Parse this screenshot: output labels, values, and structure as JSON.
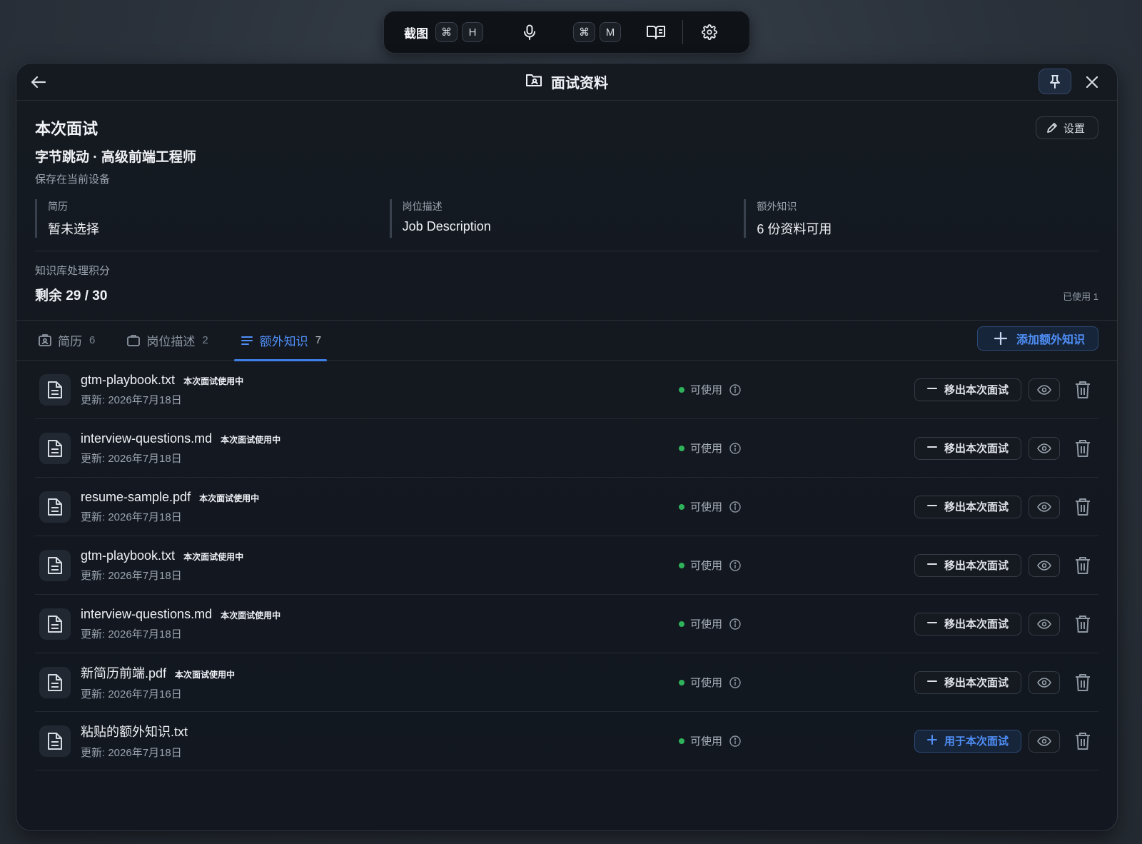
{
  "toolbar": {
    "screenshot_label": "截图",
    "shortcut1_mod": "⌘",
    "shortcut1_key": "H",
    "shortcut2_mod": "⌘",
    "shortcut2_key": "M"
  },
  "window": {
    "title": "面试资料"
  },
  "summary": {
    "heading": "本次面试",
    "position": "字节跳动 · 高级前端工程师",
    "storage_note": "保存在当前设备",
    "settings_label": "设置",
    "meta": [
      {
        "label": "简历",
        "value": "暂未选择"
      },
      {
        "label": "岗位描述",
        "value": "Job Description"
      },
      {
        "label": "额外知识",
        "value": "6 份资料可用"
      }
    ],
    "credits_label": "知识库处理积分",
    "credits_value": "剩余 29 / 30",
    "credits_used": "已使用 1"
  },
  "tabs": [
    {
      "label": "简历",
      "count": "6",
      "icon": "resume-icon"
    },
    {
      "label": "岗位描述",
      "count": "2",
      "icon": "briefcase-icon"
    },
    {
      "label": "额外知识",
      "count": "7",
      "icon": "list-icon",
      "active": true
    }
  ],
  "add_button_label": "添加额外知识",
  "status_label": "可使用",
  "files": [
    {
      "name": "gtm-playbook.txt",
      "tag": "本次面试使用中",
      "date": "更新: 2026年7月18日",
      "action": "移出本次面试",
      "action_type": "remove"
    },
    {
      "name": "interview-questions.md",
      "tag": "本次面试使用中",
      "date": "更新: 2026年7月18日",
      "action": "移出本次面试",
      "action_type": "remove"
    },
    {
      "name": "resume-sample.pdf",
      "tag": "本次面试使用中",
      "date": "更新: 2026年7月18日",
      "action": "移出本次面试",
      "action_type": "remove"
    },
    {
      "name": "gtm-playbook.txt",
      "tag": "本次面试使用中",
      "date": "更新: 2026年7月18日",
      "action": "移出本次面试",
      "action_type": "remove"
    },
    {
      "name": "interview-questions.md",
      "tag": "本次面试使用中",
      "date": "更新: 2026年7月18日",
      "action": "移出本次面试",
      "action_type": "remove"
    },
    {
      "name": "新简历前端.pdf",
      "tag": "本次面试使用中",
      "date": "更新: 2026年7月16日",
      "action": "移出本次面试",
      "action_type": "remove"
    },
    {
      "name": "粘贴的额外知识.txt",
      "tag": "",
      "date": "更新: 2026年7月18日",
      "action": "用于本次面试",
      "action_type": "add"
    }
  ]
}
